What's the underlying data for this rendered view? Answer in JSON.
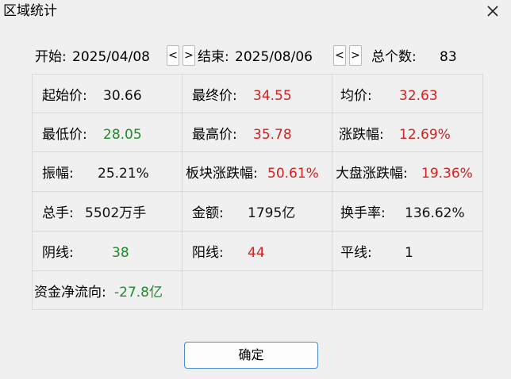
{
  "window": {
    "title": "区域统计"
  },
  "range": {
    "start_label": "开始:",
    "start_date": "2025/04/08",
    "end_label": "结束:",
    "end_date": "2025/08/06",
    "count_label": "总个数:",
    "count_value": "83",
    "prev_label": "<",
    "next_label": ">"
  },
  "stats": [
    [
      {
        "label": "起始价:",
        "value": "30.66",
        "color": "black"
      },
      {
        "label": "最终价:",
        "value": "34.55",
        "color": "red"
      },
      {
        "label": "均价:",
        "value": "32.63",
        "color": "red"
      }
    ],
    [
      {
        "label": "最低价:",
        "value": "28.05",
        "color": "green"
      },
      {
        "label": "最高价:",
        "value": "35.78",
        "color": "red"
      },
      {
        "label": "涨跌幅:",
        "value": "12.69%",
        "color": "red"
      }
    ],
    [
      {
        "label": "振幅:",
        "value": "25.21%",
        "color": "black"
      },
      {
        "label": "板块涨跌幅:",
        "value": "50.61%",
        "color": "red"
      },
      {
        "label": "大盘涨跌幅:",
        "value": "19.36%",
        "color": "red"
      }
    ],
    [
      {
        "label": "总手:",
        "value": "5502万手",
        "color": "black"
      },
      {
        "label": "金额:",
        "value": "1795亿",
        "color": "black"
      },
      {
        "label": "换手率:",
        "value": "136.62%",
        "color": "black"
      }
    ],
    [
      {
        "label": "阴线:",
        "value": "38",
        "color": "green"
      },
      {
        "label": "阳线:",
        "value": "44",
        "color": "red"
      },
      {
        "label": "平线:",
        "value": "1",
        "color": "black"
      }
    ],
    [
      {
        "label": "资金净流向:",
        "value": "-27.8亿",
        "color": "green"
      },
      {
        "label": "",
        "value": "",
        "color": "black"
      },
      {
        "label": "",
        "value": "",
        "color": "black"
      }
    ]
  ],
  "buttons": {
    "ok_label": "确定"
  },
  "colors": {
    "up": "#d6201d",
    "down": "#1e8a2d",
    "accent": "#4a8fd1"
  }
}
